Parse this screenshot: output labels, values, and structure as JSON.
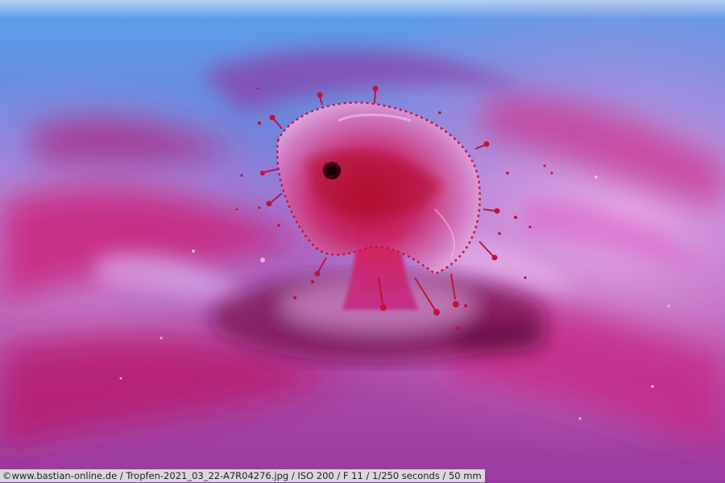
{
  "photo": {
    "subject": "water-drop-splash",
    "palette": {
      "sky_blue": "#5aa0e6",
      "lavender": "#a77fd8",
      "magenta": "#c81e78",
      "deep_red": "#8c0b3a",
      "pink_light": "#e59ad4"
    }
  },
  "caption": {
    "text": "©www.bastian-online.de / Tropfen-2021_03_22-A7R04276.jpg / ISO 200 / F 11 / 1/250 seconds  / 50 mm"
  }
}
